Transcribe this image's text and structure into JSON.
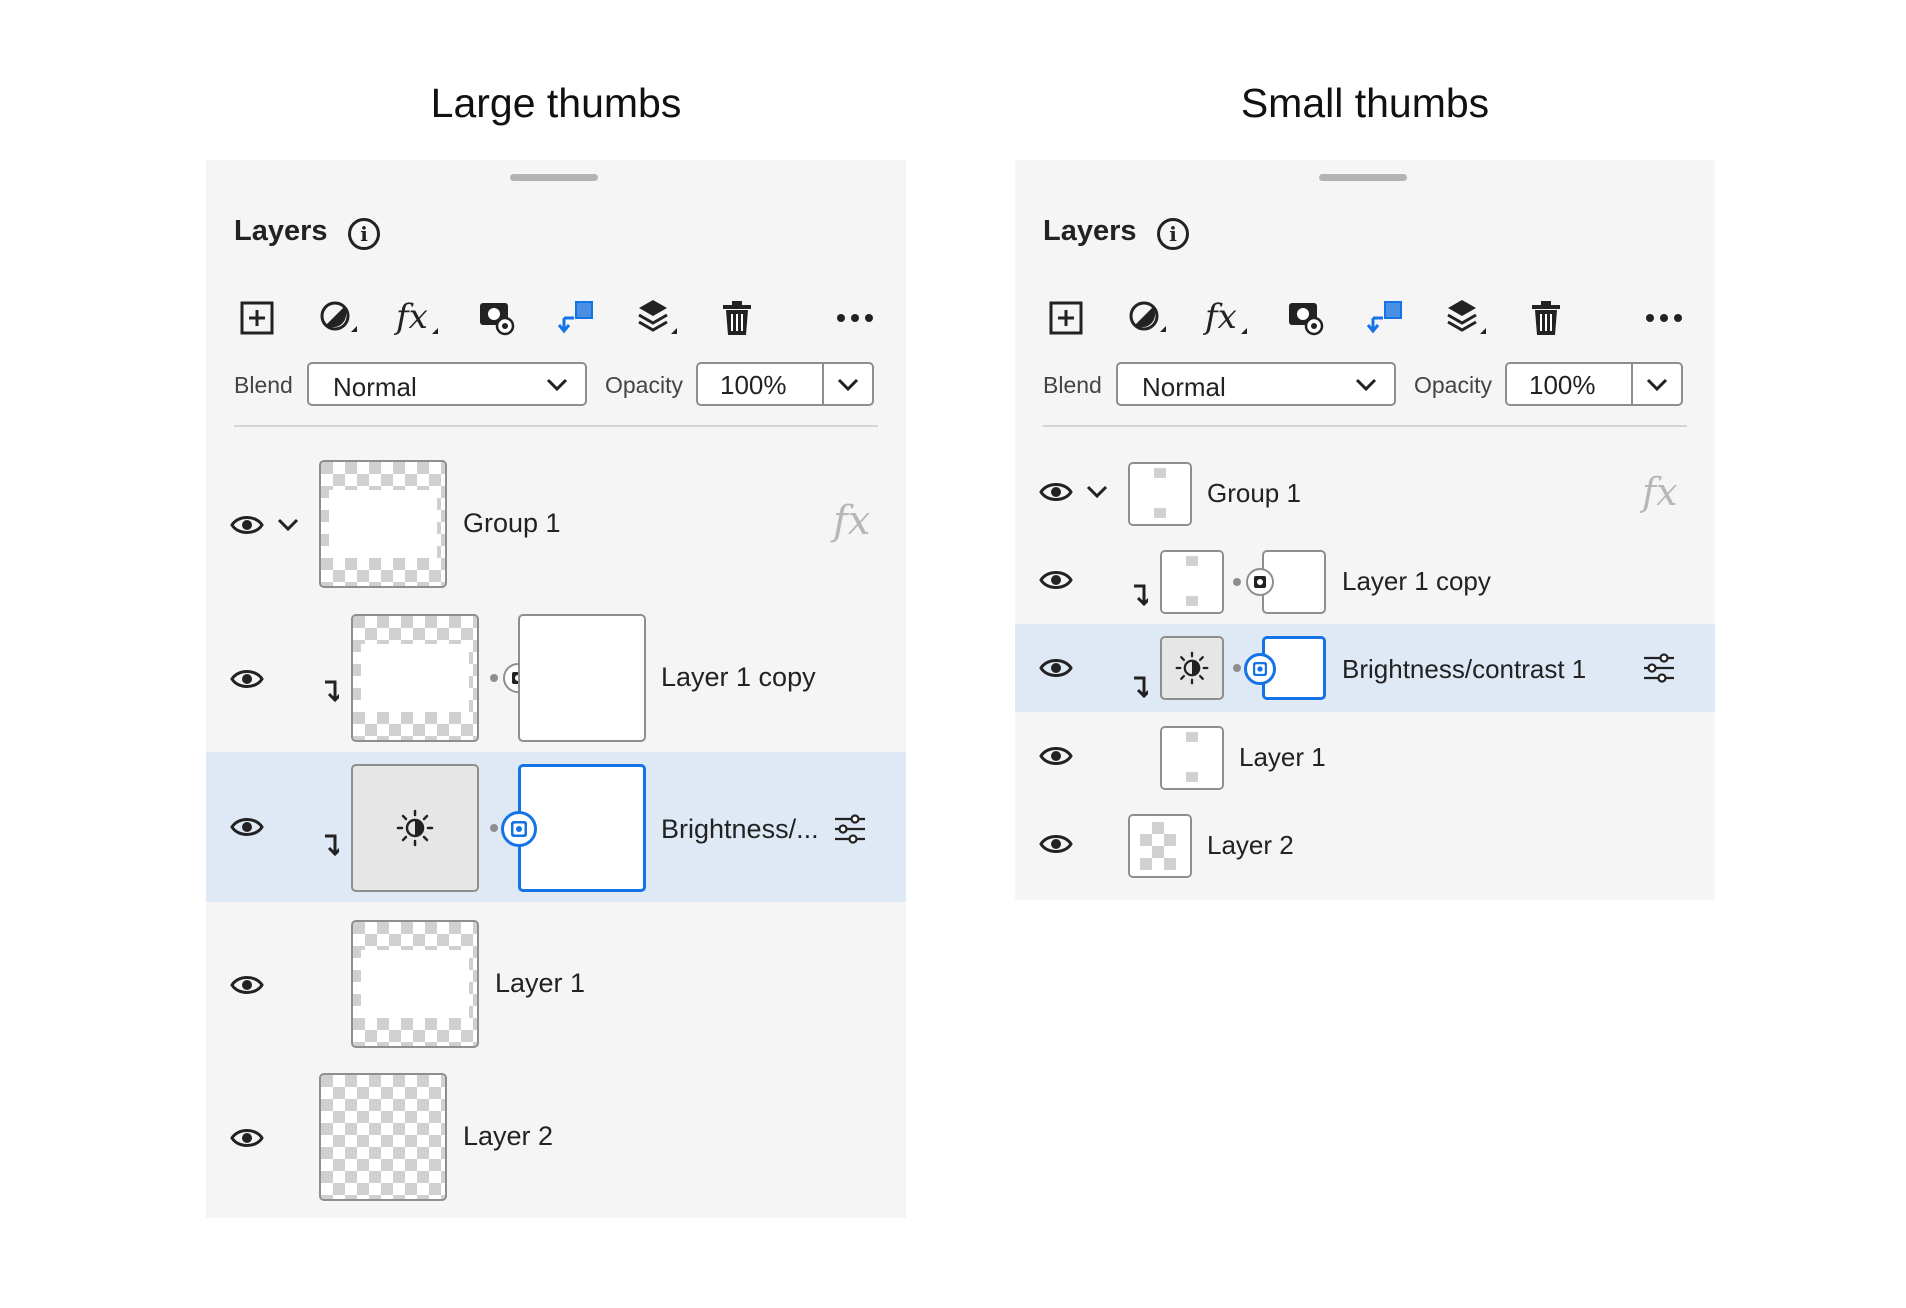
{
  "headings": {
    "large": "Large thumbs",
    "small": "Small thumbs"
  },
  "panel": {
    "title": "Layers",
    "blend_label": "Blend",
    "blend_value": "Normal",
    "opacity_label": "Opacity",
    "opacity_value": "100%",
    "toolbar_icons": [
      "add-layer-icon",
      "adjustment-layer-icon",
      "fx-icon",
      "mask-icon",
      "clipping-mask-icon",
      "layer-stack-icon",
      "delete-icon",
      "more-icon"
    ],
    "fx_text": "fx"
  },
  "large_layers": [
    {
      "name": "Group 1"
    },
    {
      "name": "Layer 1 copy"
    },
    {
      "name": "Brightness/..."
    },
    {
      "name": "Layer 1"
    },
    {
      "name": "Layer 2"
    }
  ],
  "small_layers": [
    {
      "name": "Group 1"
    },
    {
      "name": "Layer 1 copy"
    },
    {
      "name": "Brightness/contrast 1"
    },
    {
      "name": "Layer 1"
    },
    {
      "name": "Layer 2"
    }
  ],
  "colors": {
    "accent": "#1473e6",
    "selected_row": "#dfe9f5",
    "panel_bg": "#f5f5f5"
  }
}
